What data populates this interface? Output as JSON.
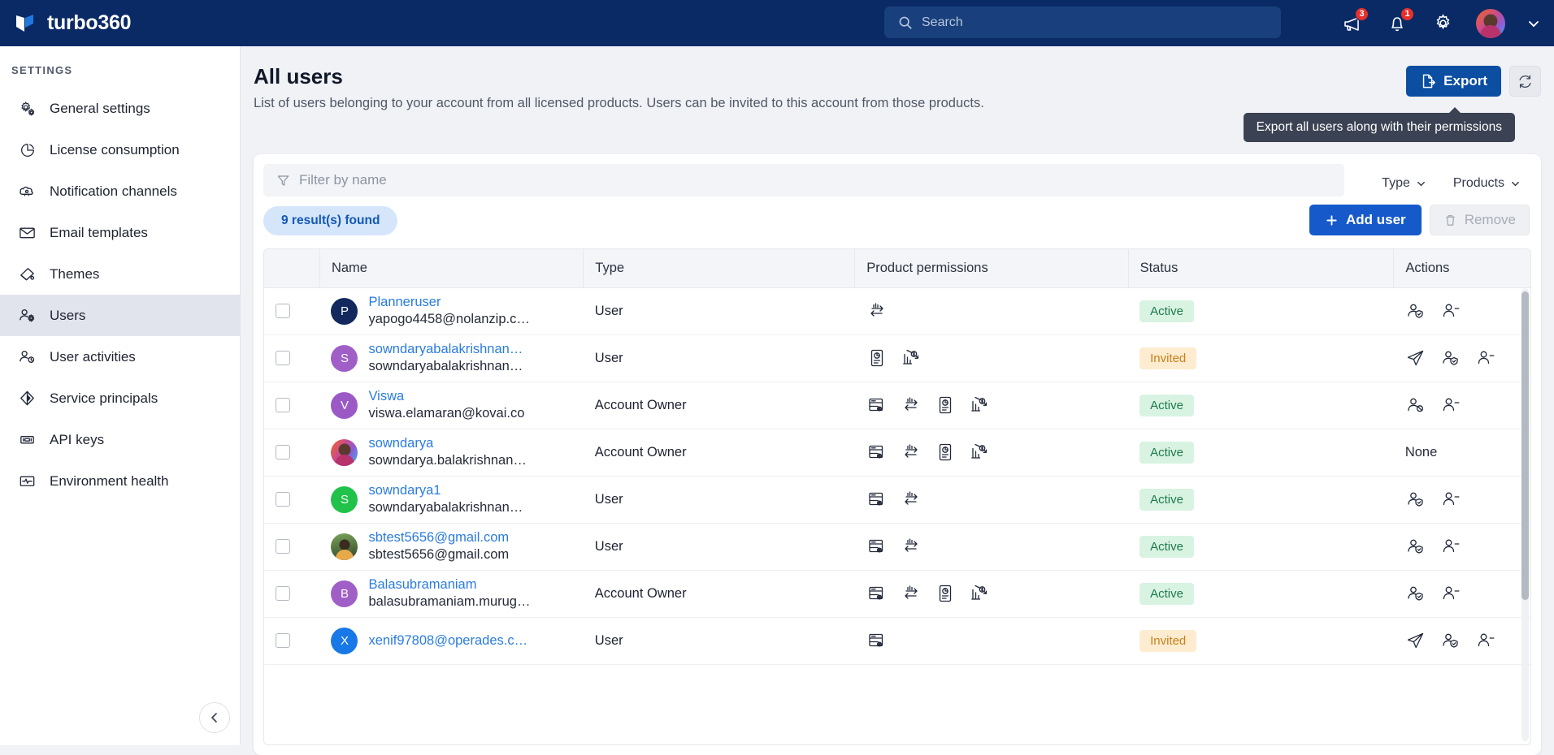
{
  "brand": {
    "name": "turbo360",
    "logo_icon": "turbo360-logo-icon"
  },
  "header": {
    "search_placeholder": "Search",
    "announcements_badge": "3",
    "notifications_badge": "1",
    "icons": [
      "megaphone-icon",
      "bell-icon",
      "gear-icon",
      "avatar",
      "chevron-down-icon"
    ]
  },
  "sidebar": {
    "section_title": "SETTINGS",
    "items": [
      {
        "label": "General settings",
        "icon": "gears-icon",
        "active": false
      },
      {
        "label": "License consumption",
        "icon": "pie-chart-icon",
        "active": false
      },
      {
        "label": "Notification channels",
        "icon": "notification-cloud-icon",
        "active": false
      },
      {
        "label": "Email templates",
        "icon": "envelope-icon",
        "active": false
      },
      {
        "label": "Themes",
        "icon": "paint-roller-icon",
        "active": false
      },
      {
        "label": "Users",
        "icon": "users-gear-icon",
        "active": true
      },
      {
        "label": "User activities",
        "icon": "user-clock-icon",
        "active": false
      },
      {
        "label": "Service principals",
        "icon": "diamond-icon",
        "active": false
      },
      {
        "label": "API keys",
        "icon": "key-card-icon",
        "active": false
      },
      {
        "label": "Environment health",
        "icon": "health-monitor-icon",
        "active": false
      }
    ],
    "collapse_icon": "chevron-left-icon"
  },
  "page": {
    "title": "All users",
    "subtitle": "List of users belonging to your account from all licensed products. Users can be invited to this account from those products.",
    "export_label": "Export",
    "export_icon": "export-file-icon",
    "refresh_icon": "refresh-icon",
    "tooltip": "Export all users along with their permissions"
  },
  "filters": {
    "name_placeholder": "Filter by name",
    "filter_icon": "funnel-icon",
    "type_label": "Type",
    "products_label": "Products",
    "chevron_icon": "chevron-down-icon"
  },
  "toolbar": {
    "result_count": "9 result(s) found",
    "add_user_label": "Add user",
    "add_icon": "plus-icon",
    "remove_label": "Remove",
    "remove_icon": "trash-icon"
  },
  "table": {
    "columns": [
      "Name",
      "Type",
      "Product permissions",
      "Status",
      "Actions"
    ],
    "rows": [
      {
        "name": "Planneruser",
        "email": "yapogo4458@nolanzip.co…",
        "type": "User",
        "avatar": {
          "kind": "initial",
          "letter": "P",
          "color": "#13295e"
        },
        "permissions": [
          "integrate-icon"
        ],
        "status": "Active",
        "status_kind": "active",
        "actions": [
          "user-shield-icon",
          "user-minus-icon"
        ]
      },
      {
        "name": "sowndaryabalakrishnan@…",
        "email": "sowndaryabalakrishnan@…",
        "type": "User",
        "avatar": {
          "kind": "initial",
          "letter": "S",
          "color": "#a05fc6"
        },
        "permissions": [
          "insights-doc-icon",
          "cost-analytics-icon"
        ],
        "status": "Invited",
        "status_kind": "invited",
        "actions": [
          "send-invite-icon",
          "user-shield-icon",
          "user-minus-icon"
        ]
      },
      {
        "name": "Viswa",
        "email": "viswa.elamaran@kovai.co",
        "type": "Account Owner",
        "avatar": {
          "kind": "initial",
          "letter": "V",
          "color": "#9b59c6"
        },
        "permissions": [
          "bam-server-icon",
          "integrate-icon",
          "insights-doc-icon",
          "cost-analytics-icon"
        ],
        "status": "Active",
        "status_kind": "active",
        "actions": [
          "user-block-icon",
          "user-minus-icon"
        ]
      },
      {
        "name": "sowndarya",
        "email": "sowndarya.balakrishnan…",
        "type": "Account Owner",
        "avatar": {
          "kind": "photo",
          "letter": "",
          "color": "#f26522"
        },
        "permissions": [
          "bam-server-icon",
          "integrate-icon",
          "insights-doc-icon",
          "cost-analytics-icon"
        ],
        "status": "Active",
        "status_kind": "active",
        "actions": [],
        "actions_none": "None"
      },
      {
        "name": "sowndarya1",
        "email": "sowndaryabalakrishnan@…",
        "type": "User",
        "avatar": {
          "kind": "initial",
          "letter": "S",
          "color": "#21c24a"
        },
        "permissions": [
          "bam-server-icon",
          "integrate-icon"
        ],
        "status": "Active",
        "status_kind": "active",
        "actions": [
          "user-shield-icon",
          "user-minus-icon"
        ]
      },
      {
        "name": "sbtest5656@gmail.com",
        "email": "sbtest5656@gmail.com",
        "type": "User",
        "avatar": {
          "kind": "photo2",
          "letter": "",
          "color": "#5c7a4a"
        },
        "permissions": [
          "bam-server-icon",
          "integrate-icon"
        ],
        "status": "Active",
        "status_kind": "active",
        "actions": [
          "user-shield-icon",
          "user-minus-icon"
        ]
      },
      {
        "name": "Balasubramaniam",
        "email": "balasubramaniam.murug…",
        "type": "Account Owner",
        "avatar": {
          "kind": "initial",
          "letter": "B",
          "color": "#a05fc6"
        },
        "permissions": [
          "bam-server-icon",
          "integrate-icon",
          "insights-doc-icon",
          "cost-analytics-icon"
        ],
        "status": "Active",
        "status_kind": "active",
        "actions": [
          "user-shield-icon",
          "user-minus-icon"
        ]
      },
      {
        "name": "xenif97808@operades.com",
        "email": "",
        "type": "User",
        "avatar": {
          "kind": "initial",
          "letter": "X",
          "color": "#1878e8"
        },
        "permissions": [
          "bam-server-icon"
        ],
        "status": "Invited",
        "status_kind": "invited",
        "actions": [
          "send-invite-icon",
          "user-shield-icon",
          "user-minus-icon"
        ]
      }
    ]
  }
}
